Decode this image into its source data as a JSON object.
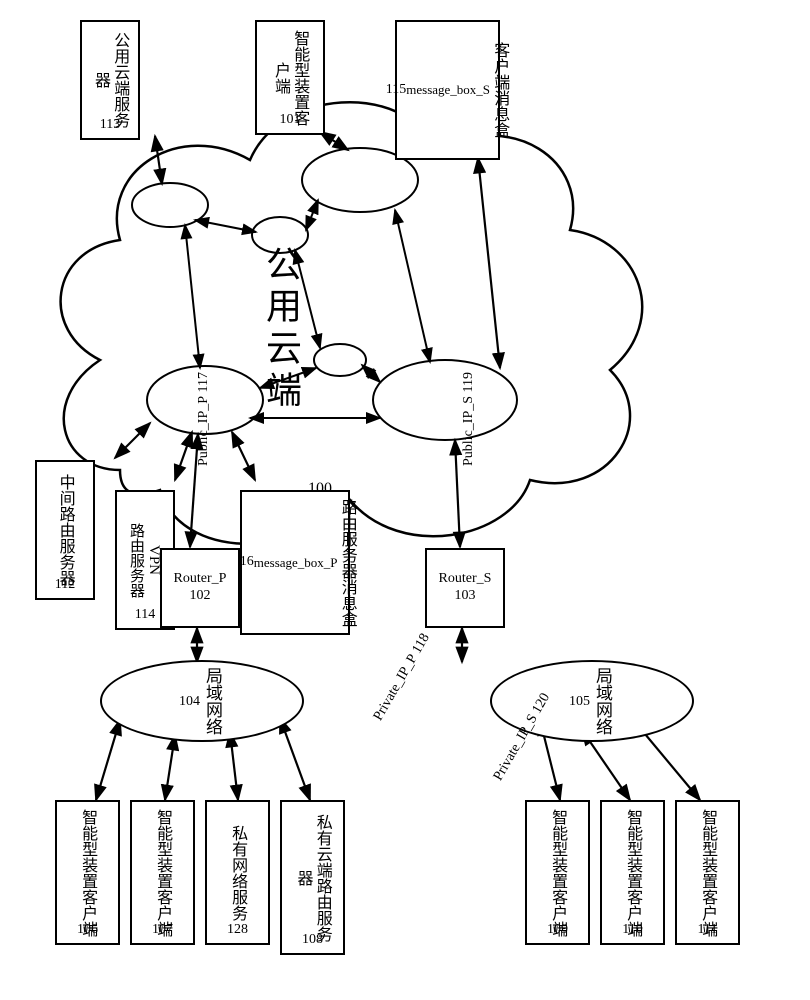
{
  "cloud": {
    "label": "公用云端",
    "id": "100"
  },
  "top_boxes": {
    "public_cloud_server": {
      "text": "公用云端服务器",
      "id": "113"
    },
    "smart_client_top": {
      "text": "智能型装置客户端",
      "id": "101"
    },
    "client_msgbox": {
      "text": "客户端消息盒",
      "sub": "message_box_S",
      "id": "115"
    },
    "mid_route_server": {
      "text": "中间路由服务器",
      "id": "112"
    },
    "vpn_route_server": {
      "text": "VPN路由服务器",
      "id": "114"
    },
    "route_server_msgbox": {
      "text": "路由服务器消息盒",
      "sub": "message_box_P",
      "id": "116"
    }
  },
  "routers": {
    "router_p": {
      "text": "Router_P",
      "id": "102"
    },
    "router_s": {
      "text": "Router_S",
      "id": "103"
    }
  },
  "lans": {
    "lan_p": {
      "text": "局域网络",
      "id": "104"
    },
    "lan_s": {
      "text": "局域网络",
      "id": "105"
    }
  },
  "p_side": {
    "sc106": {
      "text": "智能型装置客户端",
      "id": "106"
    },
    "sc107": {
      "text": "智能型装置客户端",
      "id": "107"
    },
    "priv_net_svc": {
      "text": "私有网络服务",
      "id": "128"
    },
    "priv_cloud_router": {
      "text": "私有云端路由服务器",
      "id": "108"
    }
  },
  "s_side": {
    "sc109": {
      "text": "智能型装置客户端",
      "id": "109"
    },
    "sc110": {
      "text": "智能型装置客户端",
      "id": "110"
    },
    "sc111": {
      "text": "智能型装置客户端",
      "id": "111"
    }
  },
  "ip_labels": {
    "pub_p": {
      "text": "Public_IP_P",
      "id": "117"
    },
    "pub_s": {
      "text": "Public_IP_S",
      "id": "119"
    },
    "priv_p": {
      "text": "Private_IP_P",
      "id": "118"
    },
    "priv_s": {
      "text": "Private_IP_S",
      "id": "120"
    }
  }
}
